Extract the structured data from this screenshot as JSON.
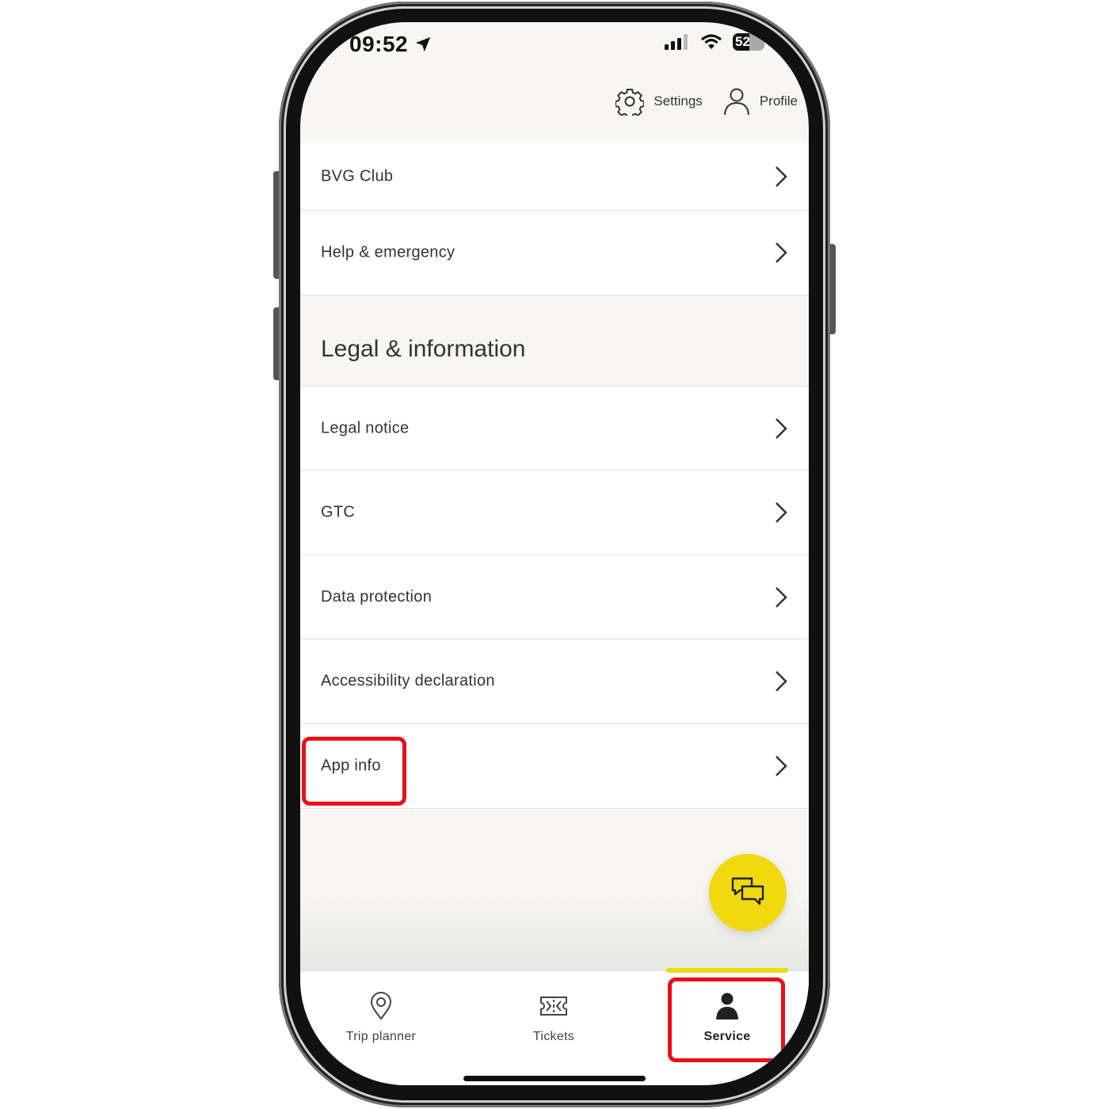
{
  "status_bar": {
    "time": "09:52",
    "battery": "52"
  },
  "header": {
    "settings_label": "Settings",
    "profile_label": "Profile"
  },
  "menu_items": [
    {
      "label": "BVG Club"
    },
    {
      "label": "Help & emergency"
    }
  ],
  "legal_section": {
    "title": "Legal & information",
    "items": [
      {
        "label": "Legal notice"
      },
      {
        "label": "GTC"
      },
      {
        "label": "Data protection"
      },
      {
        "label": "Accessibility declaration"
      },
      {
        "label": "App info"
      }
    ]
  },
  "tabs": [
    {
      "label": "Trip planner"
    },
    {
      "label": "Tickets"
    },
    {
      "label": "Service",
      "active": true
    }
  ],
  "colors": {
    "accent": "#f0d90f",
    "highlight": "#e8101a",
    "background": "#f7f6f2"
  },
  "icons": [
    "location-arrow-icon",
    "signal-icon",
    "wifi-icon",
    "battery-icon",
    "gear-icon",
    "user-icon",
    "chevron-right-icon",
    "chat-bubbles-icon",
    "map-pin-icon",
    "ticket-icon",
    "person-icon"
  ]
}
